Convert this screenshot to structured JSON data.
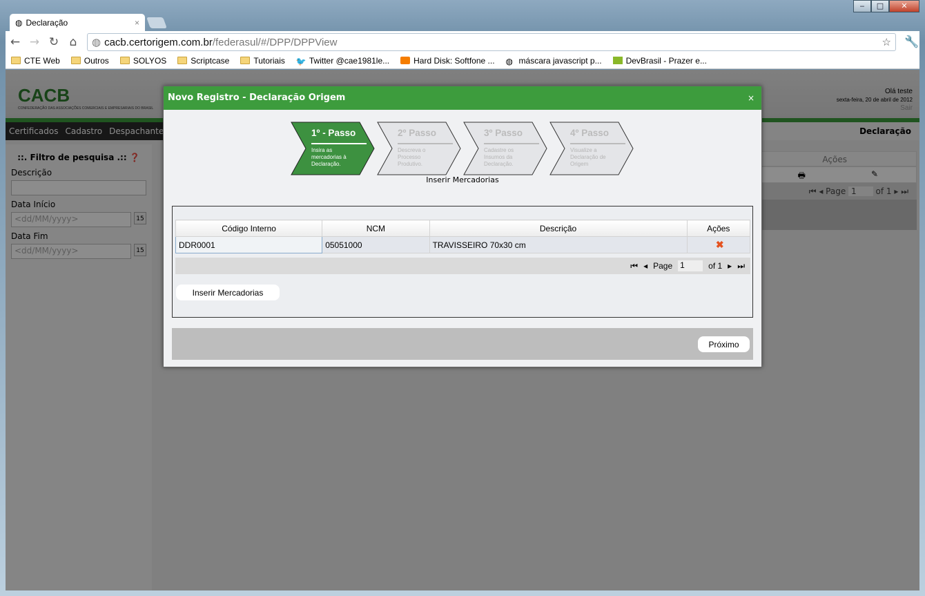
{
  "browser": {
    "tab_title": "Declaração",
    "url_host": "cacb.certorigem.com.br",
    "url_path": "/federasul/#/DPP/DPPView",
    "bookmarks": [
      "CTE Web",
      "Outros",
      "SOLYOS",
      "Scriptcase",
      "Tutoriais",
      "Twitter @cae1981le...",
      "Hard Disk: Softfone ...",
      "máscara javascript p...",
      "DevBrasil - Prazer e..."
    ]
  },
  "header": {
    "logo": "CACB",
    "logo_sub": "CONFEDERAÇÃO DAS ASSOCIAÇÕES COMERCIAIS E EMPRESARIAIS DO BRASIL",
    "greeting": "Olá teste",
    "date": "sexta-feira, 20 de abril de 2012",
    "logout": "Sair"
  },
  "menu": {
    "items": [
      "Certificados",
      "Cadastro",
      "Despachantes"
    ],
    "page_title": "Declaração"
  },
  "filter": {
    "title": "::. Filtro de pesquisa .::",
    "descricao": "Descrição",
    "data_inicio": "Data Início",
    "data_fim": "Data Fim",
    "date_placeholder": "<dd/MM/yyyy>",
    "cal": "15"
  },
  "bg_grid": {
    "col_acoes": "Ações",
    "page_label": "Page",
    "page": "1",
    "of": "of 1"
  },
  "modal": {
    "title": "Novo Registro - Declaração Origem",
    "close": "×",
    "steps": [
      {
        "title": "1º - Passo",
        "desc": "Insira as mercadorias à Declaração."
      },
      {
        "title": "2º Passo",
        "desc": "Descreva o Processo Produtivo."
      },
      {
        "title": "3º Passo",
        "desc": "Cadastre os Insumos da Declaração."
      },
      {
        "title": "4º Passo",
        "desc": "Visualize a Declaração de Origem"
      }
    ],
    "subtitle": "Inserir Mercadorias",
    "table": {
      "columns": [
        "Código Interno",
        "NCM",
        "Descrição",
        "Ações"
      ],
      "rows": [
        {
          "codigo": "DDR0001",
          "ncm": "05051000",
          "descricao": "TRAVISSEIRO 70x30 cm",
          "acao": "✖"
        }
      ]
    },
    "pager": {
      "label": "Page",
      "page": "1",
      "of": "of 1"
    },
    "insert_button": "Inserir Mercadorias",
    "next_button": "Próximo"
  },
  "colors": {
    "accent": "#3d9c3d"
  }
}
